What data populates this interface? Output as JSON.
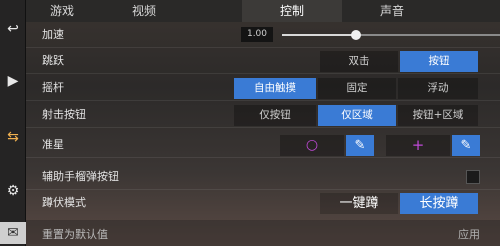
{
  "tabs": [
    "游戏",
    "视频",
    "控制",
    "声音"
  ],
  "active_tab": "控制",
  "sidebar": {
    "icons": [
      "back-arrow-icon",
      "play-icon",
      "swap-arrows-icon",
      "gear-icon",
      "mail-icon"
    ],
    "items": [
      {
        "label": "",
        "icon": "back-arrow-icon",
        "glyph": "↩"
      },
      {
        "label": "",
        "icon": "play-icon",
        "glyph": "▶"
      },
      {
        "label": "",
        "icon": "swap-arrows-icon",
        "glyph": "⇆"
      },
      {
        "label": "",
        "icon": "gear-icon",
        "glyph": "⚙"
      },
      {
        "label": "",
        "icon": "mail-icon",
        "glyph": "✉"
      }
    ]
  },
  "settings": {
    "speed": {
      "label": "加速",
      "value": "1.00",
      "slider_fraction": 0.33
    },
    "jump": {
      "label": "跳跃",
      "options": [
        "双击",
        "按钮"
      ],
      "selected": "按钮"
    },
    "joystick": {
      "label": "摇杆",
      "options": [
        "自由触摸",
        "固定",
        "浮动"
      ],
      "selected": "自由触摸"
    },
    "shoot": {
      "label": "射击按钮",
      "options": [
        "仅按钮",
        "仅区域",
        "按钮+区域"
      ],
      "selected": "仅区域"
    },
    "crosshair": {
      "label": "准星",
      "options": [
        {
          "icon": "circle-crosshair-icon",
          "glyph": "○",
          "edit_icon": "pencil-icon",
          "edit_glyph": "✎"
        },
        {
          "icon": "cross-crosshair-icon",
          "glyph": "+",
          "edit_icon": "pencil-icon",
          "edit_glyph": "✎"
        }
      ]
    },
    "grenade": {
      "label": "辅助手榴弹按钮",
      "checked": false
    },
    "crouch": {
      "label": "蹲伏模式",
      "options": [
        "一键蹲",
        "长按蹲"
      ],
      "selected": "长按蹲"
    }
  },
  "footer": {
    "reset": "重置为默认值",
    "apply": "应用"
  },
  "colors": {
    "accent": "#3a7bd5",
    "crosshair_circle": "#c04ad8",
    "crosshair_cross": "#c04ad8"
  }
}
